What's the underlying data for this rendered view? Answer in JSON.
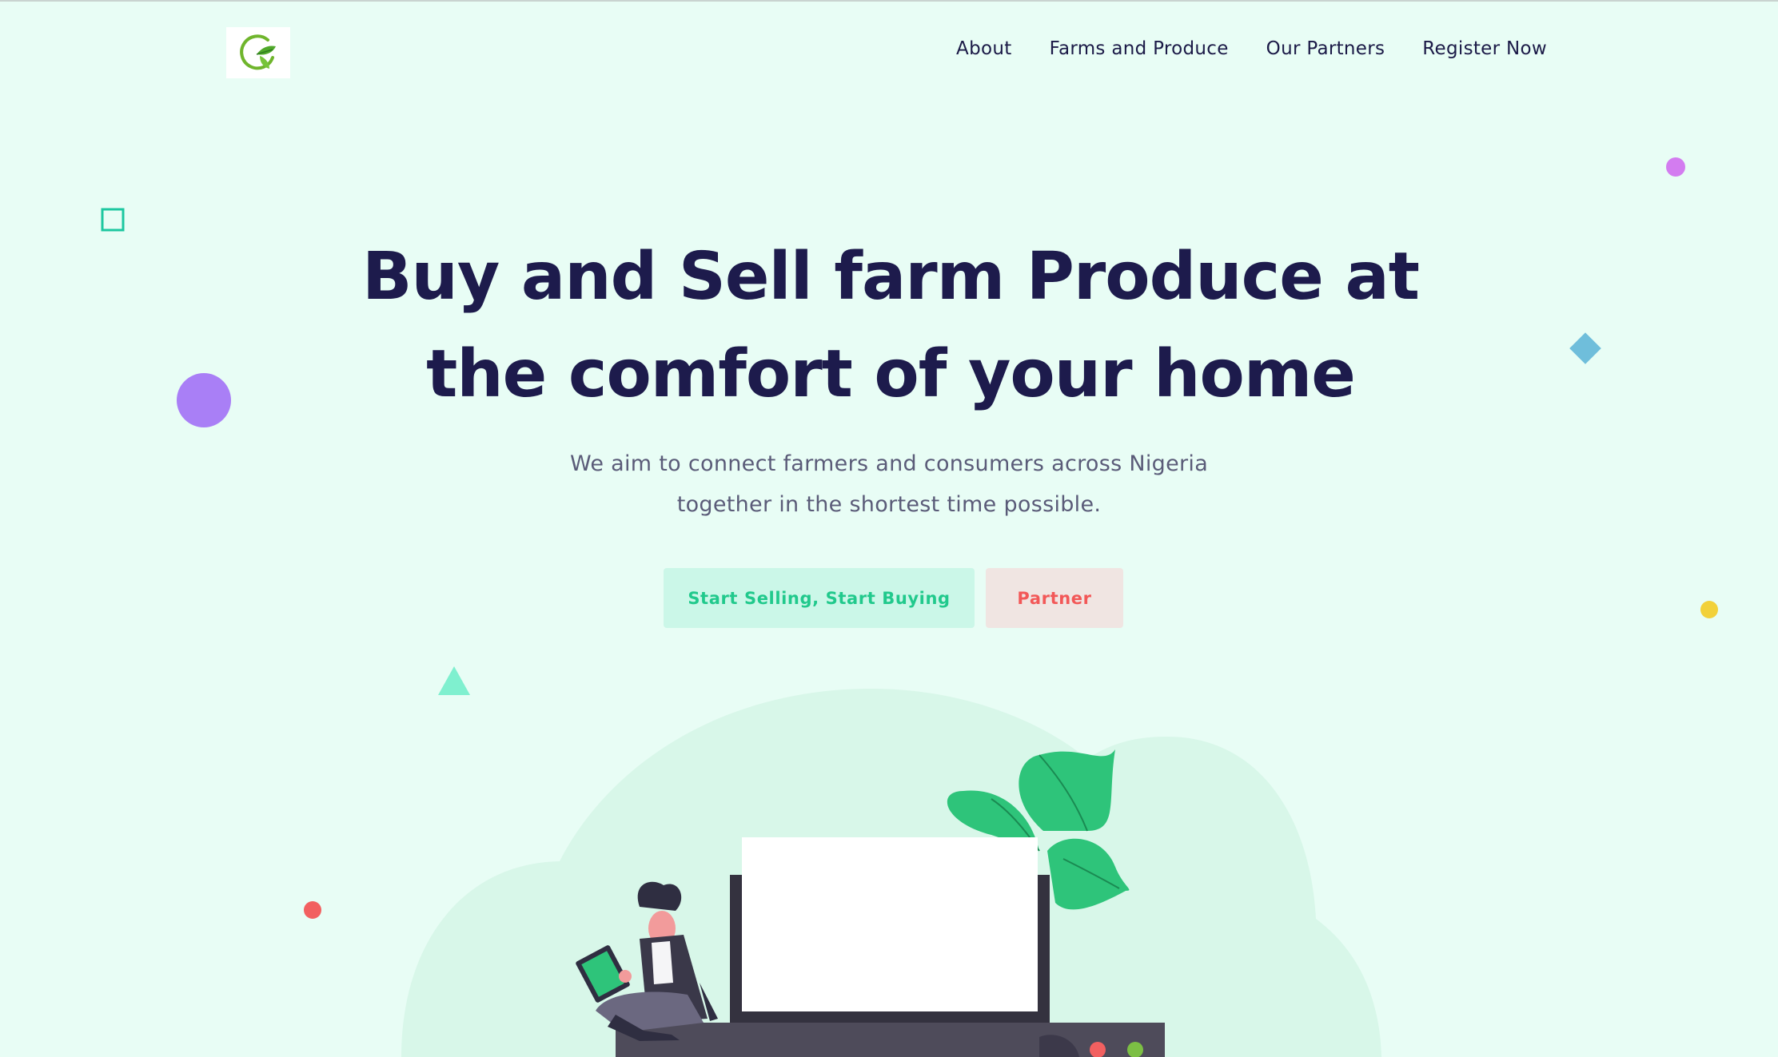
{
  "nav": {
    "items": [
      {
        "label": "About"
      },
      {
        "label": "Farms and Produce"
      },
      {
        "label": "Our Partners"
      },
      {
        "label": "Register Now"
      }
    ]
  },
  "hero": {
    "title_line1": "Buy and Sell farm Produce at",
    "title_line2": "the comfort of your home",
    "subtitle_line1": "We aim to connect farmers and consumers across Nigeria",
    "subtitle_line2": "together in the shortest time possible.",
    "primary_button": "Start Selling, Start Buying",
    "secondary_button": "Partner"
  },
  "colors": {
    "background": "#e8fdf5",
    "heading": "#1d1b4c",
    "primary_text": "#21c98c",
    "primary_bg": "#cbf7e8",
    "secondary_text": "#f25858",
    "secondary_bg": "#f0e5e2"
  },
  "icons": {
    "logo": "leaf-ring-logo",
    "illustration": "person-with-tablet-and-laptop"
  }
}
